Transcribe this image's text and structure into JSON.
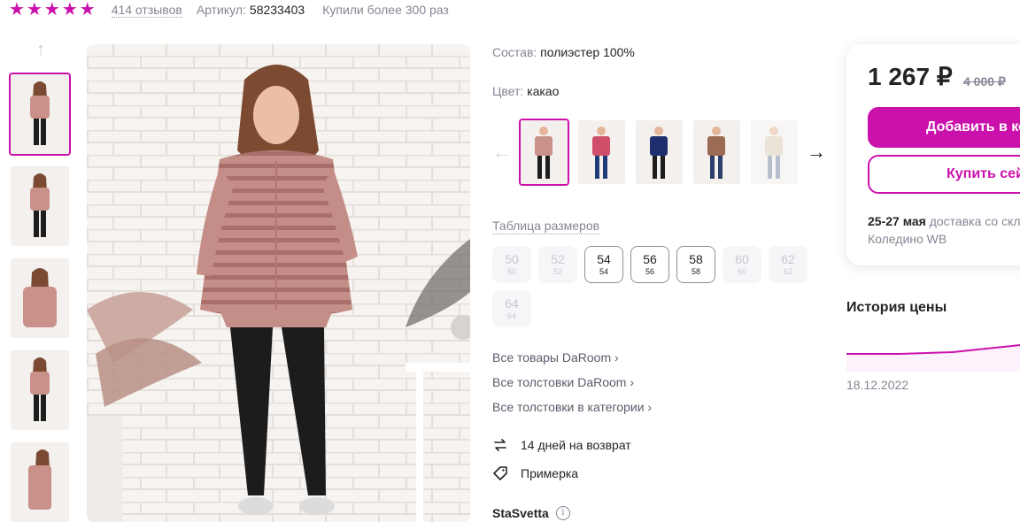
{
  "rating": {
    "stars": 5,
    "reviews": "414 отзывов",
    "article_label": "Артикул:",
    "article_value": "58233403",
    "bought": "Купили более 300 раз"
  },
  "specs": {
    "composition_label": "Состав:",
    "composition_value": "полиэстер 100%",
    "color_label": "Цвет:",
    "color_value": "какао"
  },
  "size_table_link": "Таблица размеров",
  "sizes": [
    {
      "ru": "50",
      "eu": "50",
      "available": false
    },
    {
      "ru": "52",
      "eu": "52",
      "available": false
    },
    {
      "ru": "54",
      "eu": "54",
      "available": true
    },
    {
      "ru": "56",
      "eu": "56",
      "available": true
    },
    {
      "ru": "58",
      "eu": "58",
      "available": true
    },
    {
      "ru": "60",
      "eu": "60",
      "available": false
    },
    {
      "ru": "62",
      "eu": "62",
      "available": false
    },
    {
      "ru": "64",
      "eu": "64",
      "available": false
    }
  ],
  "links": {
    "all_brand": "Все товары DaRoom",
    "all_brand_category": "Все толстовки DaRoom",
    "all_category": "Все толстовки в категории"
  },
  "perks": {
    "return": "14 дней на возврат",
    "fitting": "Примерка"
  },
  "seller": "StaSvetta",
  "price": {
    "current": "1 267 ₽",
    "old": "4 000 ₽"
  },
  "buttons": {
    "add_to_cart": "Добавить в корзину",
    "buy_now": "Купить сейчас"
  },
  "delivery": {
    "dates": "25-27 мая",
    "text": "доставка со склада",
    "warehouse": "Коледино WB"
  },
  "price_history": {
    "title": "История цены",
    "date": "18.12.2022"
  },
  "colors": {
    "brand": "#cb11ab"
  }
}
